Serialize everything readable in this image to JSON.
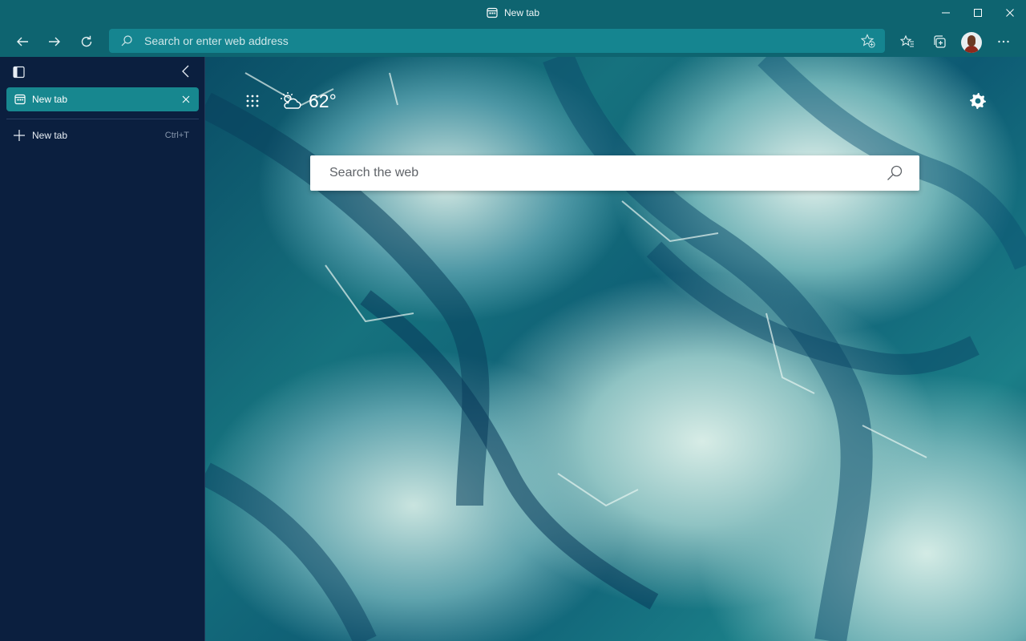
{
  "window": {
    "title": "New tab",
    "controls": [
      "minimize-icon",
      "maximize-icon",
      "close-icon"
    ]
  },
  "toolbar": {
    "address_placeholder": "Search or enter web address",
    "buttons": [
      "back-icon",
      "forward-icon",
      "refresh-icon",
      "favorites-icon",
      "collections-icon",
      "profile-avatar",
      "more-icon"
    ]
  },
  "sidebar": {
    "tabs": [
      {
        "label": "New tab",
        "active": true
      }
    ],
    "new_tab": {
      "label": "New tab",
      "shortcut": "Ctrl+T"
    }
  },
  "newtab_page": {
    "temperature": "62°",
    "weather_icon": "partly-cloudy-icon",
    "search_placeholder": "Search the web"
  },
  "colors": {
    "titlebar": "#0e6470",
    "address_bar": "#158590",
    "sidebar_bg": "#0b1f3f",
    "active_tab": "#17878f"
  }
}
